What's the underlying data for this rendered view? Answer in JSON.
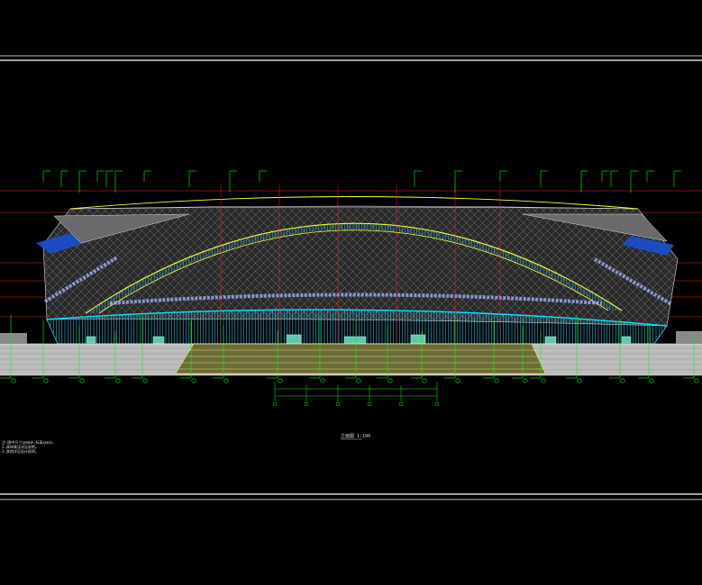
{
  "drawing": {
    "caption": "立面图 1:100",
    "notes": [
      "注:图中尺寸以mm计,标高以m计。",
      "2.具体做法详见说明。",
      "3.其他详见设计说明。"
    ],
    "colors": {
      "background": "#000000",
      "frame": "#ffffff",
      "level_lines": "#ff2020",
      "leaders": "#00ff00",
      "roof_curve": "#ffff33",
      "curtain_wall": "#33d6ff",
      "facade_mesh": "#b0b0b0",
      "ground": "#c8c8c8",
      "blue_band": "#1a4fd0"
    }
  }
}
